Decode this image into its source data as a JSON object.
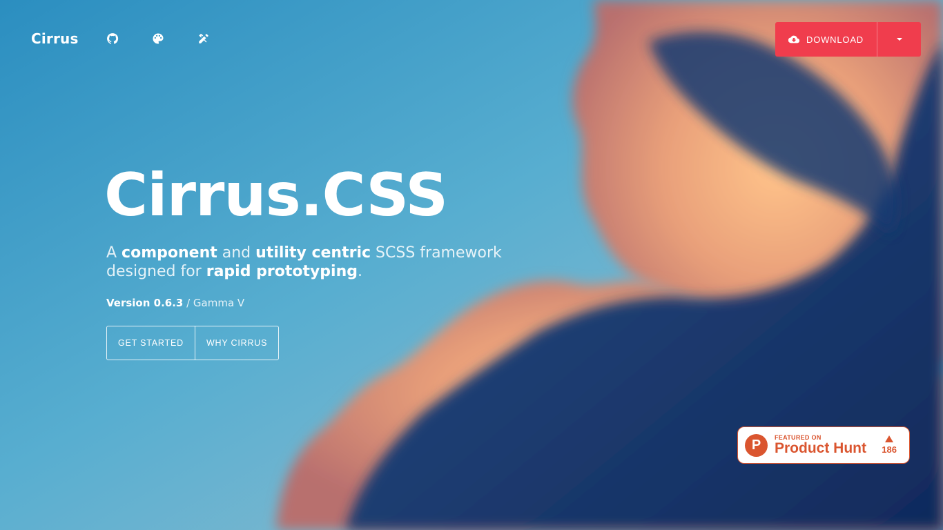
{
  "header": {
    "brand": "Cirrus",
    "nav_icons": [
      "github-icon",
      "palette-icon",
      "tools-icon"
    ],
    "download_label": "DOWNLOAD",
    "download_icon": "cloud-download-icon"
  },
  "hero": {
    "title": "Cirrus.CSS",
    "tagline": {
      "p1": "A ",
      "b1": "component",
      "p2": " and ",
      "b2": "utility centric",
      "p3": " SCSS framework designed for ",
      "b3": "rapid prototyping",
      "p4": "."
    },
    "version": {
      "number": "Version 0.6.3",
      "name": " / Gamma V"
    },
    "buttons": {
      "get_started": "GET STARTED",
      "why": "WHY CIRRUS"
    }
  },
  "product_hunt": {
    "featured": "FEATURED ON",
    "name": "Product Hunt",
    "votes": "186",
    "logo_letter": "P"
  },
  "colors": {
    "accent": "#f03d4d",
    "product_hunt": "#da552f",
    "sky": "#4aa8cc"
  }
}
